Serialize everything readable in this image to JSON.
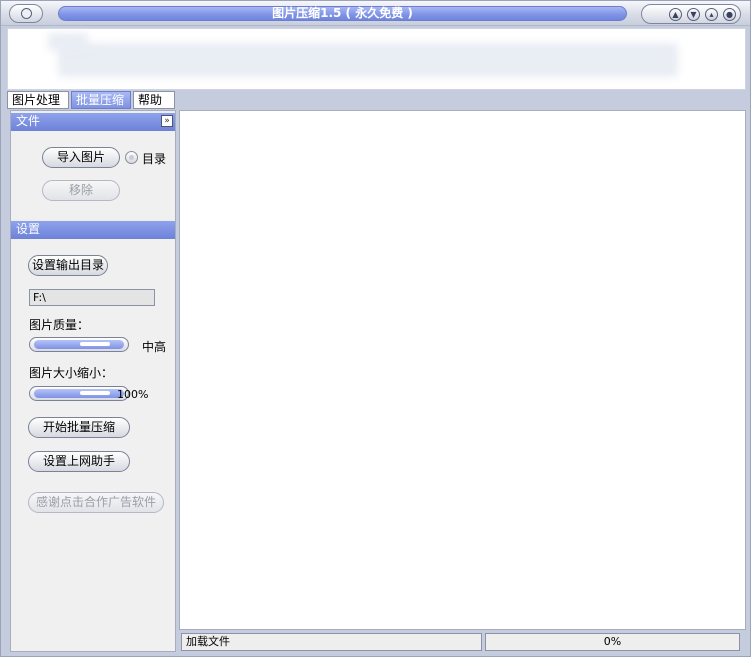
{
  "window": {
    "title": "图片压缩1.5 ( 永久免费 )"
  },
  "tabs": [
    {
      "label": "图片处理"
    },
    {
      "label": "批量压缩"
    },
    {
      "label": "帮助"
    }
  ],
  "file_section": {
    "title": "文件",
    "import_label": "导入图片",
    "directory_label": "目录",
    "remove_label": "移除"
  },
  "settings_section": {
    "title": "设置",
    "set_output_label": "设置输出目录",
    "output_path": "F:\\",
    "quality_label": "图片质量：",
    "quality_value": "中高",
    "resize_label": "图片大小缩小：",
    "resize_value": "100%",
    "start_label": "开始批量压缩",
    "net_helper_label": "设置上网助手",
    "thanks_label": "感谢点击合作广告软件"
  },
  "status_bar": {
    "message": "加载文件",
    "progress": "0%"
  },
  "colors": {
    "accent": "#7f93e6",
    "panel": "#eeeeee",
    "frame": "#c4ccdd"
  }
}
